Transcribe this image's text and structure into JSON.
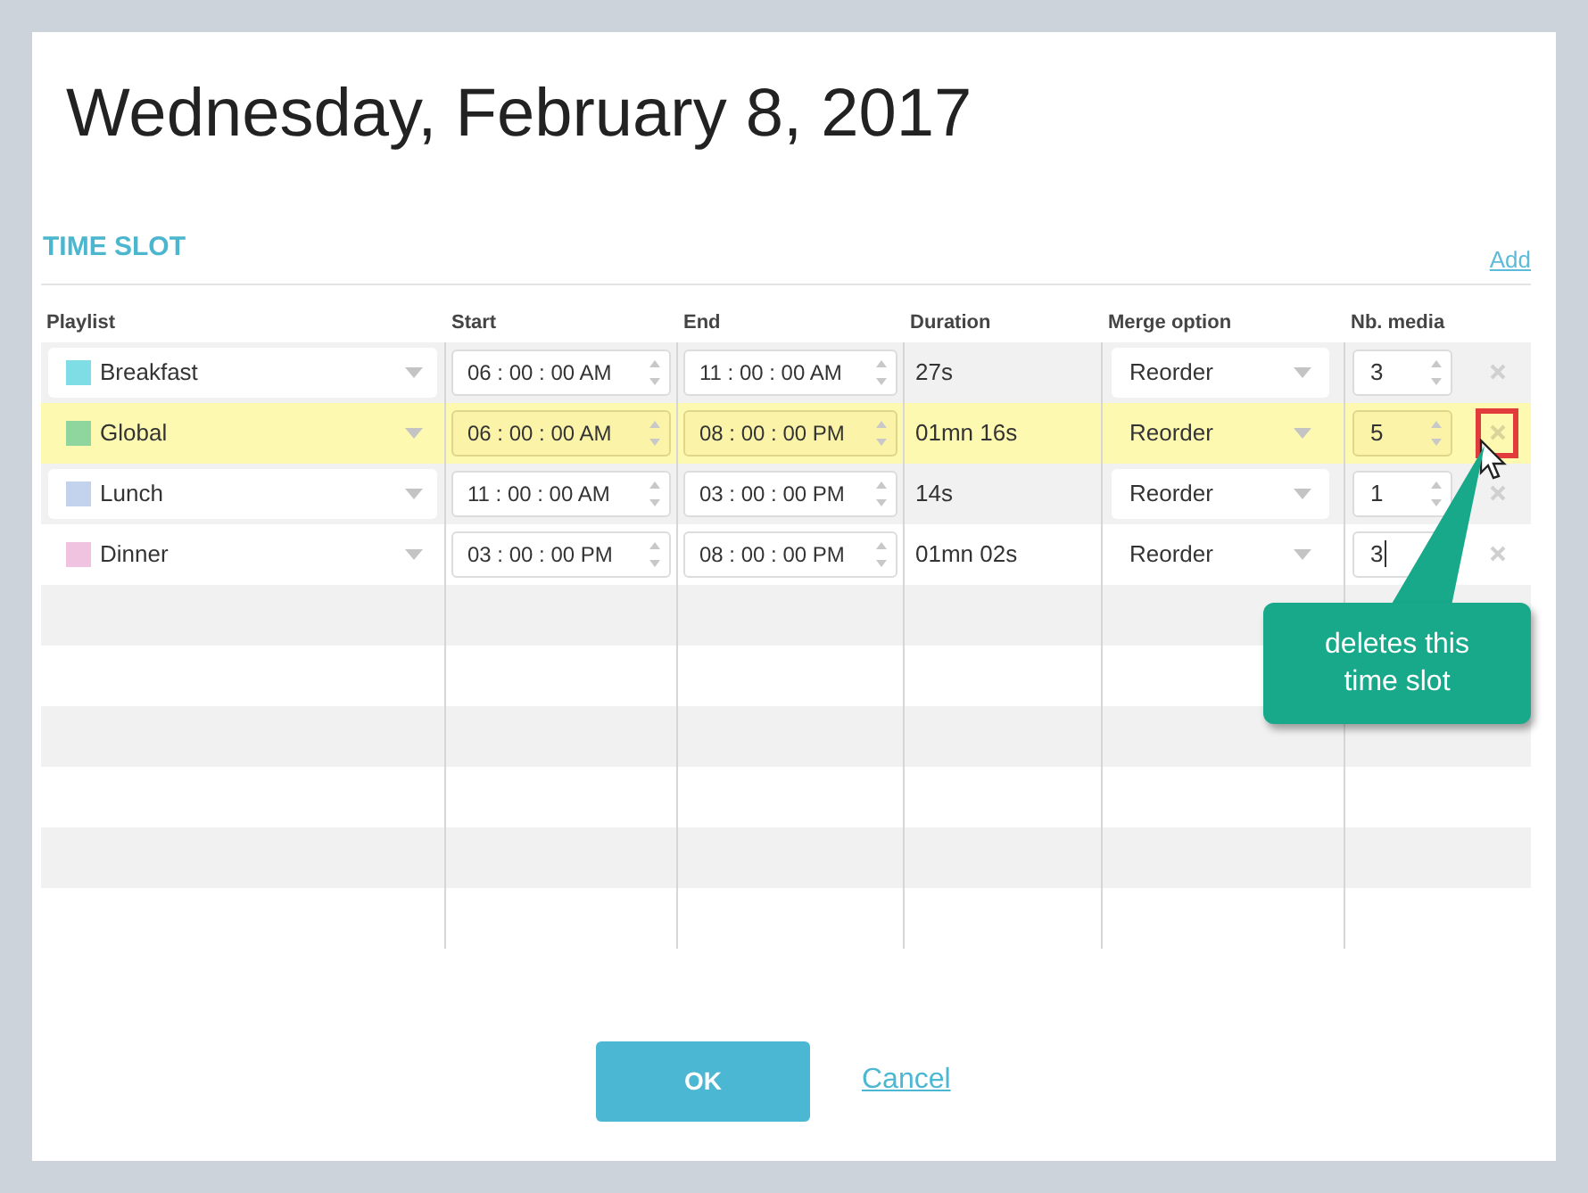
{
  "dialog": {
    "title": "Wednesday, February 8, 2017"
  },
  "section": {
    "title": "TIME SLOT",
    "add_link": "Add"
  },
  "columns": [
    "Playlist",
    "Start",
    "End",
    "Duration",
    "Merge option",
    "Nb. media"
  ],
  "rows": [
    {
      "playlist": "Breakfast",
      "color": "#7fdde6",
      "start": "06 : 00 : 00 AM",
      "end": "11 : 00 : 00 AM",
      "duration": "27s",
      "merge": "Reorder",
      "nb_media": "3",
      "selected": false,
      "delete_highlighted": false,
      "focused": false
    },
    {
      "playlist": "Global",
      "color": "#8fd69e",
      "start": "06 : 00 : 00 AM",
      "end": "08 : 00 : 00 PM",
      "duration": "01mn 16s",
      "merge": "Reorder",
      "nb_media": "5",
      "selected": true,
      "delete_highlighted": true,
      "focused": false
    },
    {
      "playlist": "Lunch",
      "color": "#c3d3ee",
      "start": "11 : 00 : 00 AM",
      "end": "03 : 00 : 00 PM",
      "duration": "14s",
      "merge": "Reorder",
      "nb_media": "1",
      "selected": false,
      "delete_highlighted": false,
      "focused": false
    },
    {
      "playlist": "Dinner",
      "color": "#f0c3e0",
      "start": "03 : 00 : 00 PM",
      "end": "08 : 00 : 00 PM",
      "duration": "01mn 02s",
      "merge": "Reorder",
      "nb_media": "3",
      "selected": false,
      "delete_highlighted": false,
      "focused": true
    }
  ],
  "callout": {
    "text": "deletes this time slot"
  },
  "buttons": {
    "ok": "OK",
    "cancel": "Cancel"
  }
}
